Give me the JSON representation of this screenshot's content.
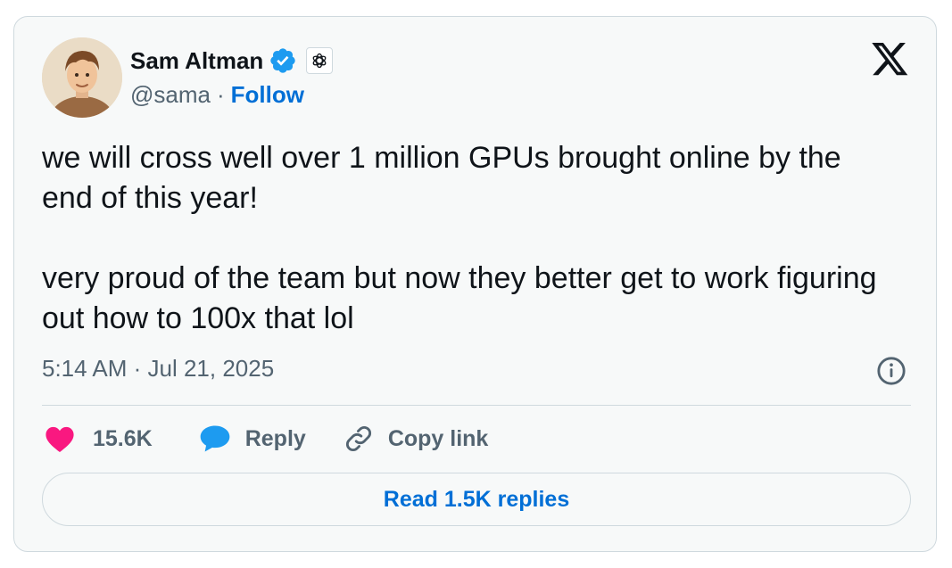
{
  "author": {
    "name": "Sam Altman",
    "handle": "@sama",
    "separator": "·",
    "follow_label": "Follow",
    "verified_color": "#1d9bf0",
    "affiliation_icon": "openai-logo-icon"
  },
  "platform": {
    "logo": "x-logo-icon"
  },
  "tweet": {
    "paragraphs": [
      "we will cross well over 1 million GPUs brought online by the end of this year!",
      "very proud of the team but now they better get to work figuring out how to 100x that lol"
    ],
    "timestamp": "5:14 AM · Jul 21, 2025"
  },
  "actions": {
    "like_count": "15.6K",
    "like_color": "#f91880",
    "reply_label": "Reply",
    "reply_color": "#1d9bf0",
    "copy_link_label": "Copy link"
  },
  "footer": {
    "read_replies_label": "Read 1.5K replies"
  },
  "colors": {
    "text_primary": "#0f1419",
    "text_secondary": "#536471",
    "link": "#006fd6",
    "border": "#cfd9de",
    "card_bg": "#f7f9f9"
  }
}
